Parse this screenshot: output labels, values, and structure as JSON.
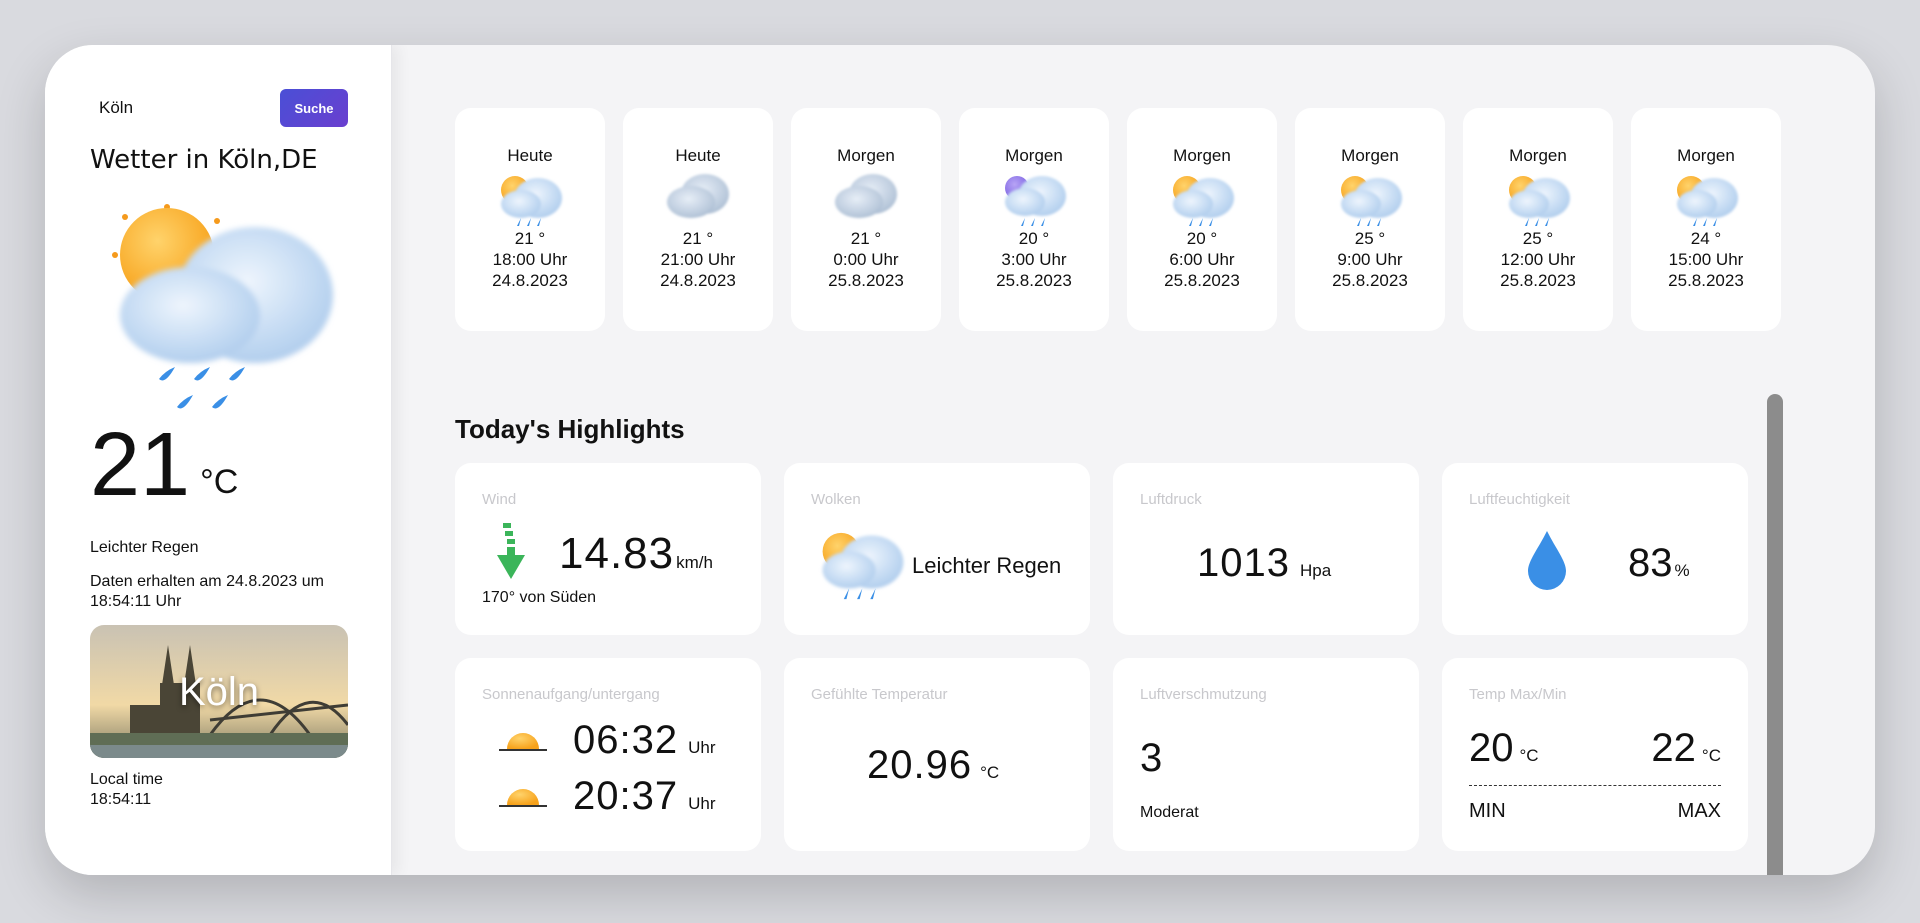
{
  "search": {
    "value": "Köln",
    "button_label": "Suche"
  },
  "current": {
    "title": "Wetter in Köln,DE",
    "temperature": "21",
    "unit": "°C",
    "description": "Leichter Regen",
    "received": "Daten erhalten am 24.8.2023 um 18:54:11 Uhr",
    "city_image_label": "Köln",
    "local_time_label": "Local time",
    "local_time_value": "18:54:11",
    "icon": "sun-cloud-rain-icon"
  },
  "forecast": [
    {
      "day": "Heute",
      "temp": "21 °",
      "time": "18:00 Uhr",
      "date": "24.8.2023",
      "icon": "sun-cloud-rain-icon"
    },
    {
      "day": "Heute",
      "temp": "21 °",
      "time": "21:00 Uhr",
      "date": "24.8.2023",
      "icon": "cloud-icon"
    },
    {
      "day": "Morgen",
      "temp": "21 °",
      "time": "0:00 Uhr",
      "date": "25.8.2023",
      "icon": "cloud-icon"
    },
    {
      "day": "Morgen",
      "temp": "20 °",
      "time": "3:00 Uhr",
      "date": "25.8.2023",
      "icon": "moon-cloud-rain-icon"
    },
    {
      "day": "Morgen",
      "temp": "20 °",
      "time": "6:00 Uhr",
      "date": "25.8.2023",
      "icon": "sun-cloud-rain-icon"
    },
    {
      "day": "Morgen",
      "temp": "25 °",
      "time": "9:00 Uhr",
      "date": "25.8.2023",
      "icon": "sun-cloud-rain-icon"
    },
    {
      "day": "Morgen",
      "temp": "25 °",
      "time": "12:00 Uhr",
      "date": "25.8.2023",
      "icon": "sun-cloud-rain-icon"
    },
    {
      "day": "Morgen",
      "temp": "24 °",
      "time": "15:00 Uhr",
      "date": "25.8.2023",
      "icon": "sun-cloud-rain-icon"
    }
  ],
  "highlights": {
    "title": "Today's Highlights",
    "wind": {
      "label": "Wind",
      "value": "14.83",
      "unit": "km/h",
      "direction": "170° von Süden",
      "icon": "arrow-down-icon"
    },
    "clouds": {
      "label": "Wolken",
      "value": "Leichter Regen",
      "icon": "sun-cloud-rain-icon"
    },
    "pressure": {
      "label": "Luftdruck",
      "value": "1013",
      "unit": "Hpa"
    },
    "humidity": {
      "label": "Luftfeuchtigkeit",
      "value": "83",
      "unit": "%",
      "icon": "water-drop-icon"
    },
    "sun": {
      "label": "Sonnenaufgang/untergang",
      "sunrise": "06:32",
      "sunset": "20:37",
      "unit": "Uhr",
      "icon": "sunrise-icon"
    },
    "feels_like": {
      "label": "Gefühlte Temperatur",
      "value": "20.96",
      "unit": "°C"
    },
    "pollution": {
      "label": "Luftverschmutzung",
      "value": "3",
      "status": "Moderat"
    },
    "temp_minmax": {
      "label": "Temp Max/Min",
      "min": "20",
      "max": "22",
      "unit": "°C",
      "min_label": "MIN",
      "max_label": "MAX"
    }
  },
  "colors": {
    "accent": "#5046d6",
    "wind_arrow": "#3bb55a",
    "drop": "#3a8fe6"
  }
}
